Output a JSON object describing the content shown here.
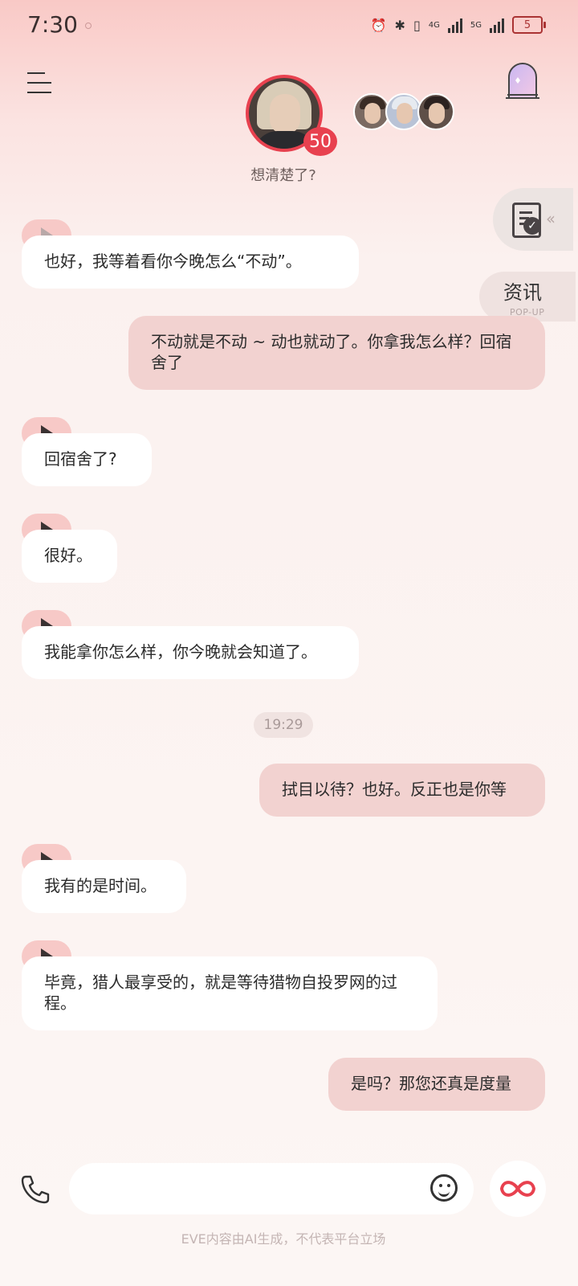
{
  "status_bar": {
    "time": "7:30",
    "network_1": "4G",
    "network_2": "5G",
    "battery_level": "5"
  },
  "header": {
    "affinity_badge": "50",
    "subtitle": "想清楚了?"
  },
  "side_widgets": {
    "popup_title": "资讯",
    "popup_sub": "POP-UP"
  },
  "messages": [
    {
      "from": "bot",
      "text": "也好，我等着看你今晚怎么“不动”。"
    },
    {
      "from": "user",
      "text": "不动就是不动 ~ 动也就动了。你拿我怎么样？回宿舍了"
    },
    {
      "from": "bot",
      "text": "回宿舍了?"
    },
    {
      "from": "bot",
      "text": "很好。"
    },
    {
      "from": "bot",
      "text": "我能拿你怎么样，你今晚就会知道了。"
    },
    {
      "from": "system",
      "text": "19:29"
    },
    {
      "from": "user",
      "text": "拭目以待？也好。反正也是你等"
    },
    {
      "from": "bot",
      "text": "我有的是时间。"
    },
    {
      "from": "bot",
      "text": "毕竟，猎人最享受的，就是等待猎物自投罗网的过程。"
    },
    {
      "from": "user",
      "text": "是吗？那您还真是度量"
    }
  ],
  "composer": {
    "placeholder": ""
  },
  "footer": {
    "disclaimer": "EVE内容由AI生成，不代表平台立场"
  },
  "colors": {
    "accent": "#e8414f",
    "user_bubble": "#f2d2d0",
    "bot_bubble": "#ffffff",
    "play_tag": "#f7c9c7"
  }
}
